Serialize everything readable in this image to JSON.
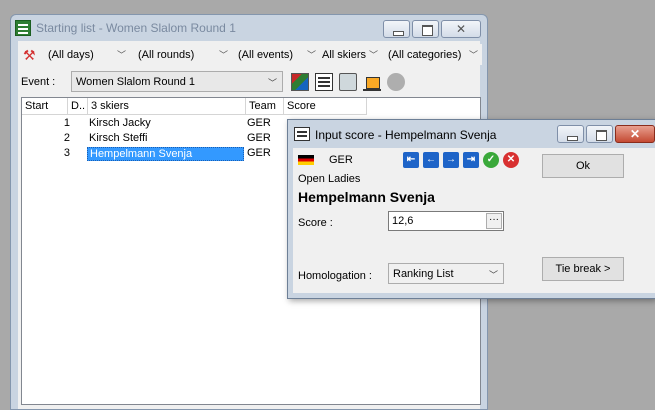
{
  "main": {
    "title": "Starting list - Women Slalom Round 1",
    "filters": {
      "days": "(All days)",
      "rounds": "(All rounds)",
      "events": "(All events)",
      "skiers": "All skiers",
      "categories": "(All categories)"
    },
    "event_label": "Event :",
    "event_value": "Women Slalom Round 1",
    "columns": [
      "Start",
      "D..",
      "3 skiers",
      "Team",
      "Score"
    ],
    "rows": [
      {
        "start": "1",
        "name": "Kirsch Jacky",
        "team": "GER"
      },
      {
        "start": "2",
        "name": "Kirsch Steffi",
        "team": "GER"
      },
      {
        "start": "3",
        "name": "Hempelmann Svenja",
        "team": "GER"
      }
    ]
  },
  "dialog": {
    "title": "Input score - Hempelmann Svenja",
    "country": "GER",
    "category": "Open Ladies",
    "name": "Hempelmann Svenja",
    "score_label": "Score :",
    "score_value": "12,6",
    "homologation_label": "Homologation :",
    "homologation_value": "Ranking List",
    "ok_label": "Ok",
    "tiebreak_label": "Tie break >"
  },
  "icons": {
    "nav": [
      "first-icon",
      "prev-icon",
      "next-icon",
      "last-icon",
      "ok-icon",
      "cancel-icon"
    ]
  },
  "colors": {
    "selection": "#3399ff",
    "titlebar": "#c9d4e1",
    "close_button": "#c44a33"
  }
}
